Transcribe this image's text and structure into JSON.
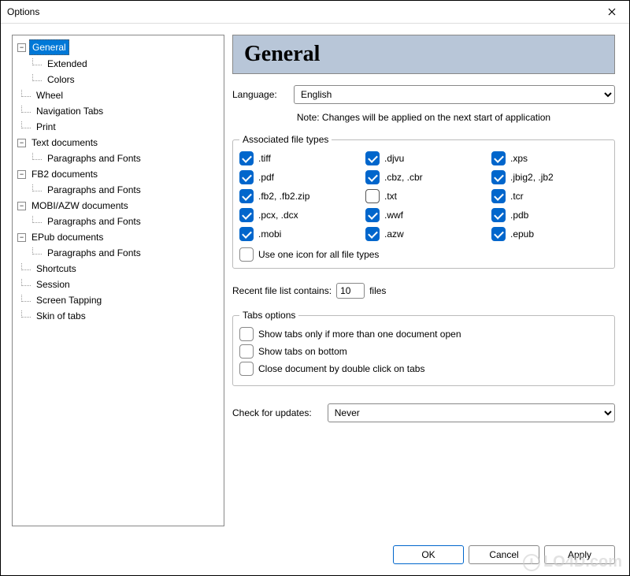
{
  "window": {
    "title": "Options"
  },
  "tree": [
    {
      "label": "General",
      "selected": true,
      "expandable": true,
      "children": [
        {
          "label": "Extended"
        },
        {
          "label": "Colors"
        }
      ]
    },
    {
      "label": "Wheel"
    },
    {
      "label": "Navigation Tabs"
    },
    {
      "label": "Print"
    },
    {
      "label": "Text documents",
      "expandable": true,
      "children": [
        {
          "label": "Paragraphs and Fonts"
        }
      ]
    },
    {
      "label": "FB2 documents",
      "expandable": true,
      "children": [
        {
          "label": "Paragraphs and Fonts"
        }
      ]
    },
    {
      "label": "MOBI/AZW documents",
      "expandable": true,
      "children": [
        {
          "label": "Paragraphs and Fonts"
        }
      ]
    },
    {
      "label": "EPub documents",
      "expandable": true,
      "children": [
        {
          "label": "Paragraphs and Fonts"
        }
      ]
    },
    {
      "label": "Shortcuts"
    },
    {
      "label": "Session"
    },
    {
      "label": "Screen Tapping"
    },
    {
      "label": "Skin of tabs"
    }
  ],
  "page": {
    "heading": "General",
    "language_label": "Language:",
    "language_value": "English",
    "note": "Note: Changes will be applied on the next start of application",
    "filetypes_legend": "Associated file types",
    "filetypes": [
      {
        "label": ".tiff",
        "checked": true
      },
      {
        "label": ".djvu",
        "checked": true
      },
      {
        "label": ".xps",
        "checked": true
      },
      {
        "label": ".pdf",
        "checked": true
      },
      {
        "label": ".cbz, .cbr",
        "checked": true
      },
      {
        "label": ".jbig2, .jb2",
        "checked": true
      },
      {
        "label": ".fb2, .fb2.zip",
        "checked": true
      },
      {
        "label": ".txt",
        "checked": false
      },
      {
        "label": ".tcr",
        "checked": true
      },
      {
        "label": ".pcx, .dcx",
        "checked": true
      },
      {
        "label": ".wwf",
        "checked": true
      },
      {
        "label": ".pdb",
        "checked": true
      },
      {
        "label": ".mobi",
        "checked": true
      },
      {
        "label": ".azw",
        "checked": true
      },
      {
        "label": ".epub",
        "checked": true
      }
    ],
    "use_one_icon": {
      "label": "Use one icon for all file types",
      "checked": false
    },
    "recent_prefix": "Recent file list contains:",
    "recent_value": "10",
    "recent_suffix": "files",
    "tabs_legend": "Tabs options",
    "tabs_opts": [
      {
        "label": "Show tabs only if more than one document open",
        "checked": false
      },
      {
        "label": "Show tabs on bottom",
        "checked": false
      },
      {
        "label": "Close document by double click on tabs",
        "checked": false
      }
    ],
    "updates_label": "Check for updates:",
    "updates_value": "Never"
  },
  "buttons": {
    "ok": "OK",
    "cancel": "Cancel",
    "apply": "Apply"
  },
  "watermark": "LO4D.com"
}
